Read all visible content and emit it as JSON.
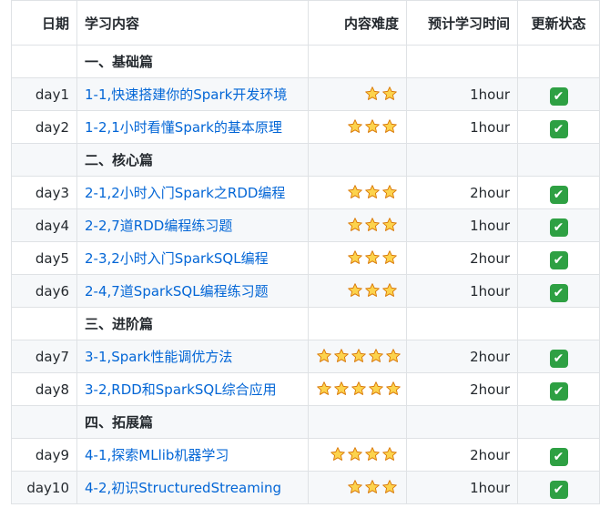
{
  "table": {
    "headers": {
      "date": "日期",
      "content": "学习内容",
      "difficulty": "内容难度",
      "time": "预计学习时间",
      "status": "更新状态"
    },
    "rows": [
      {
        "kind": "section",
        "date": "",
        "content": "一、基础篇",
        "stars": 0,
        "time": "",
        "status": ""
      },
      {
        "kind": "lesson",
        "date": "day1",
        "content": "1-1,快速搭建你的Spark开发环境",
        "stars": 2,
        "time": "1hour",
        "status": "✔"
      },
      {
        "kind": "lesson",
        "date": "day2",
        "content": "1-2,1小时看懂Spark的基本原理",
        "stars": 3,
        "time": "1hour",
        "status": "✔"
      },
      {
        "kind": "section",
        "date": "",
        "content": "二、核心篇",
        "stars": 0,
        "time": "",
        "status": ""
      },
      {
        "kind": "lesson",
        "date": "day3",
        "content": "2-1,2小时入门Spark之RDD编程",
        "stars": 3,
        "time": "2hour",
        "status": "✔"
      },
      {
        "kind": "lesson",
        "date": "day4",
        "content": "2-2,7道RDD编程练习题",
        "stars": 3,
        "time": "1hour",
        "status": "✔"
      },
      {
        "kind": "lesson",
        "date": "day5",
        "content": "2-3,2小时入门SparkSQL编程",
        "stars": 3,
        "time": "2hour",
        "status": "✔"
      },
      {
        "kind": "lesson",
        "date": "day6",
        "content": "2-4,7道SparkSQL编程练习题",
        "stars": 3,
        "time": "1hour",
        "status": "✔"
      },
      {
        "kind": "section",
        "date": "",
        "content": "三、进阶篇",
        "stars": 0,
        "time": "",
        "status": ""
      },
      {
        "kind": "lesson",
        "date": "day7",
        "content": "3-1,Spark性能调优方法",
        "stars": 5,
        "time": "2hour",
        "status": "✔"
      },
      {
        "kind": "lesson",
        "date": "day8",
        "content": "3-2,RDD和SparkSQL综合应用",
        "stars": 5,
        "time": "2hour",
        "status": "✔"
      },
      {
        "kind": "section",
        "date": "",
        "content": "四、拓展篇",
        "stars": 0,
        "time": "",
        "status": ""
      },
      {
        "kind": "lesson",
        "date": "day9",
        "content": "4-1,探索MLlib机器学习",
        "stars": 4,
        "time": "2hour",
        "status": "✔"
      },
      {
        "kind": "lesson",
        "date": "day10",
        "content": "4-2,初识StructuredStreaming",
        "stars": 3,
        "time": "1hour",
        "status": "✔"
      }
    ]
  },
  "colors": {
    "link": "#0366d6",
    "border": "#dfe2e5",
    "stripe": "#f6f8fa",
    "check": "#2ea043",
    "star_fill": "#fcd34d",
    "star_stroke": "#d97706"
  },
  "icons": {
    "difficulty": "star-icon",
    "status": "check-mark-icon"
  }
}
